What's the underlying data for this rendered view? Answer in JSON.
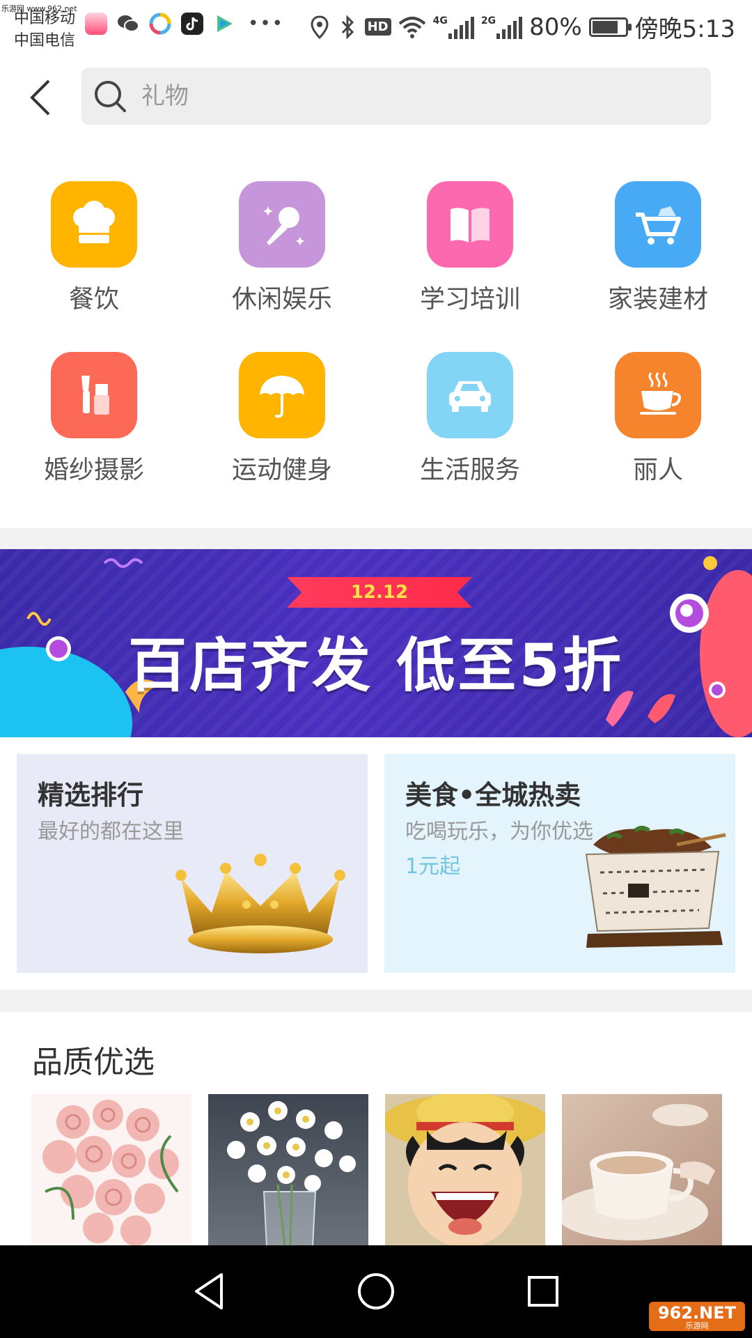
{
  "status_bar": {
    "watermark": "乐游网 www.962.net",
    "carrier_1": "中国移动",
    "carrier_2": "中国电信",
    "hd": "HD",
    "net_1": "4G",
    "net_2": "2G",
    "battery": "80%",
    "battery_level": 0.8,
    "time": "傍晚5:13"
  },
  "search": {
    "placeholder": "礼物"
  },
  "categories": [
    {
      "label": "餐饮",
      "icon": "chef-hat-icon",
      "color": "#ffb400"
    },
    {
      "label": "休闲娱乐",
      "icon": "microphone-icon",
      "color": "#c795d9"
    },
    {
      "label": "学习培训",
      "icon": "book-icon",
      "color": "#fc69ae"
    },
    {
      "label": "家装建材",
      "icon": "cart-icon",
      "color": "#48a9f5"
    },
    {
      "label": "婚纱摄影",
      "icon": "makeup-icon",
      "color": "#fc6a57"
    },
    {
      "label": "运动健身",
      "icon": "umbrella-icon",
      "color": "#ffb400"
    },
    {
      "label": "生活服务",
      "icon": "car-icon",
      "color": "#82d5f4"
    },
    {
      "label": "丽人",
      "icon": "coffee-icon",
      "color": "#f5842c"
    }
  ],
  "banner": {
    "ribbon": "12.12",
    "title": "百店齐发 低至5折"
  },
  "promos": [
    {
      "title": "精选排行",
      "subtitle": "最好的都在这里",
      "image": "crown-icon"
    },
    {
      "title": "美食•全城热卖",
      "subtitle": "吃喝玩乐，为你优选",
      "price": "1元起",
      "image": "grilled-food-image"
    }
  ],
  "quality": {
    "title": "品质优选",
    "items": [
      "roses-image",
      "daisies-image",
      "cartoon-image",
      "coffee-cup-image"
    ]
  },
  "watermark_bottom": {
    "text": "962.NET",
    "sub": "乐游网"
  }
}
